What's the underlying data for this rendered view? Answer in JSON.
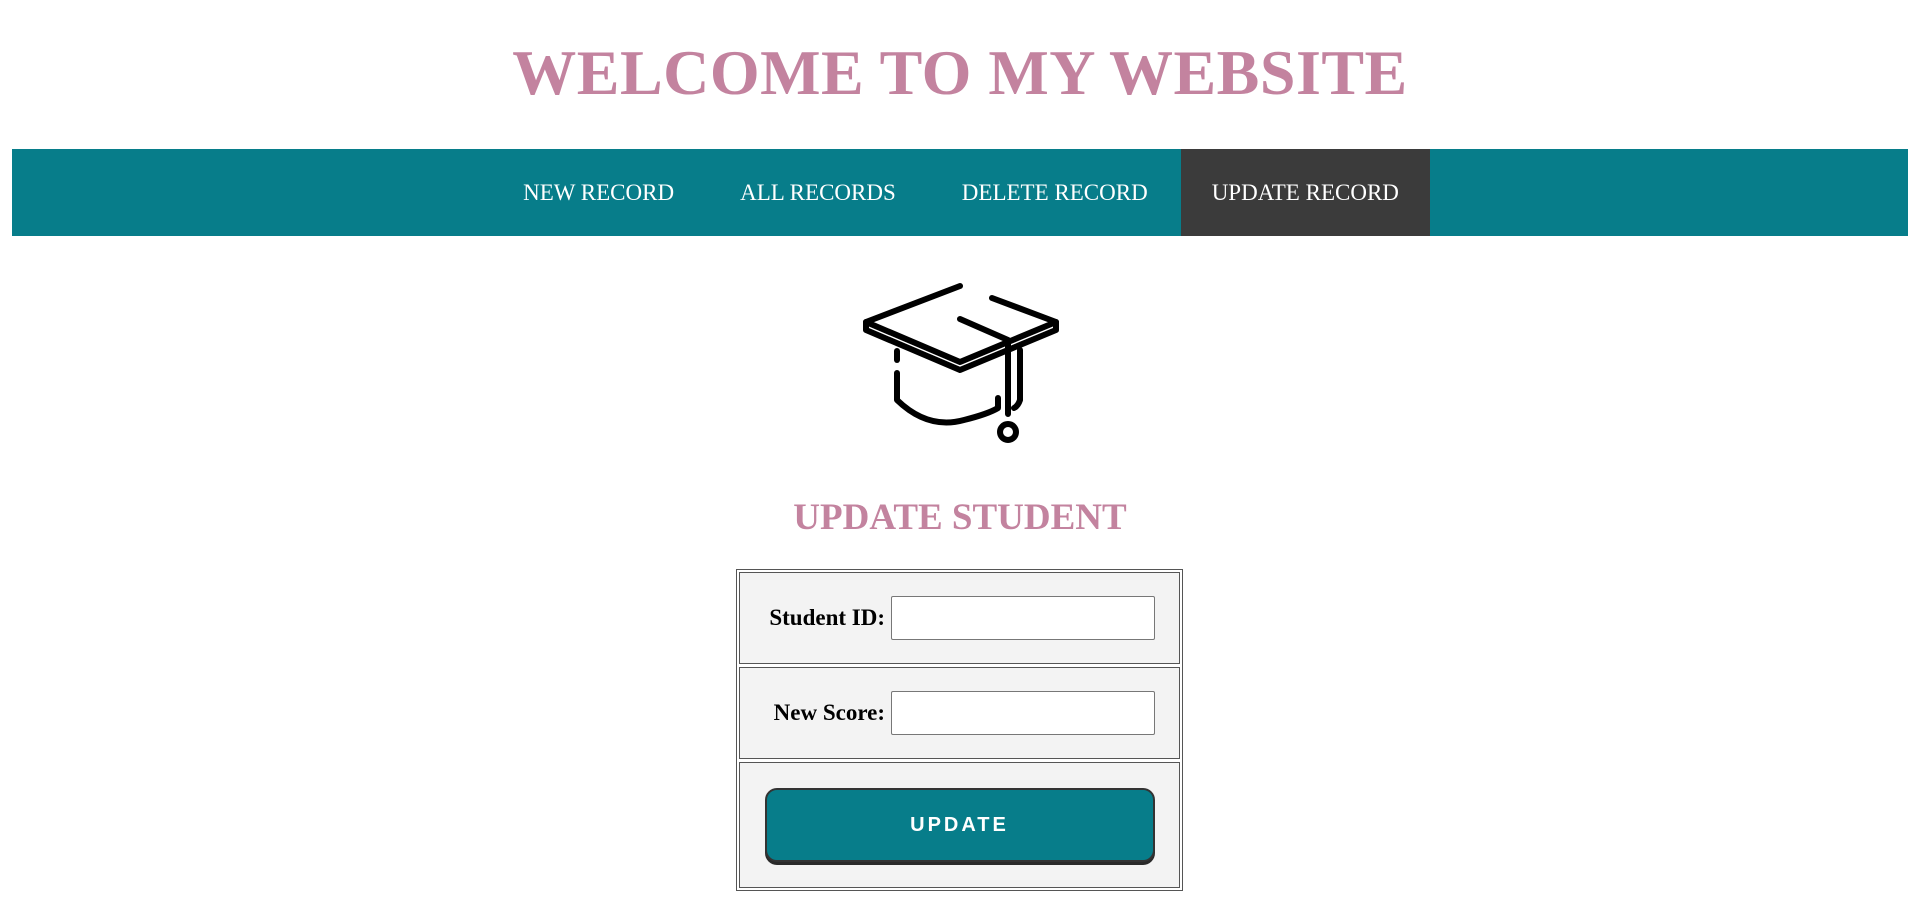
{
  "header": {
    "title": "WELCOME TO MY WEBSITE"
  },
  "nav": {
    "items": [
      {
        "label": "NEW RECORD",
        "active": false
      },
      {
        "label": "ALL RECORDS",
        "active": false
      },
      {
        "label": "DELETE RECORD",
        "active": false
      },
      {
        "label": "UPDATE RECORD",
        "active": true
      }
    ]
  },
  "hero": {
    "icon": "graduation-cap-icon"
  },
  "form": {
    "title": "UPDATE STUDENT",
    "student_id_label": "Student ID:",
    "student_id_value": "",
    "new_score_label": "New Score:",
    "new_score_value": "",
    "submit_label": "UPDATE"
  },
  "colors": {
    "accent": "#077d8a",
    "title_pink": "#c3839f",
    "nav_active": "#3b3b3b"
  }
}
